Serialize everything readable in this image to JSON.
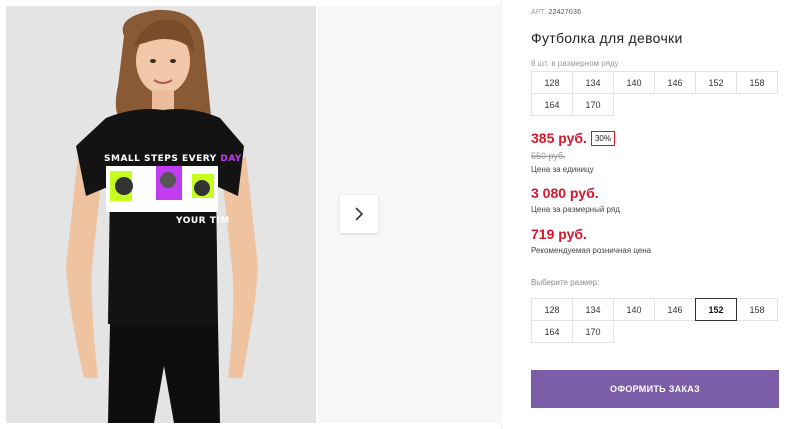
{
  "product": {
    "art_label": "АРТ.",
    "art_number": "22427036",
    "title": "Футболка для девочки",
    "tshirt_print_line1": "SMALL STEPS EVERY",
    "tshirt_print_line1_accent": "DAY",
    "tshirt_print_line2": "YOUR TIM"
  },
  "size_row": {
    "label": "8 шт. в размерном ряду",
    "sizes": [
      "128",
      "134",
      "140",
      "146",
      "152",
      "158",
      "164",
      "170"
    ]
  },
  "pricing": {
    "unit_price": "385 руб.",
    "discount": "30%",
    "old_price": "550 руб.",
    "unit_caption": "Цена за единицу",
    "row_price": "3 080 руб.",
    "row_caption": "Цена за размерный ряд",
    "retail_price": "719 руб.",
    "retail_caption": "Рекомендуемая розничная цена"
  },
  "size_picker": {
    "label": "Выберите размер:",
    "sizes": [
      "128",
      "134",
      "140",
      "146",
      "152",
      "158",
      "164",
      "170"
    ],
    "selected": "152"
  },
  "order_button": {
    "label": "ОФОРМИТЬ ЗАКАЗ"
  },
  "colors": {
    "price_red": "#d8152c",
    "button_purple": "#7b5ea7",
    "print_lime": "#c6ff1e",
    "print_violet": "#c13cf0"
  },
  "icons": {
    "next": "chevron-right-icon"
  }
}
